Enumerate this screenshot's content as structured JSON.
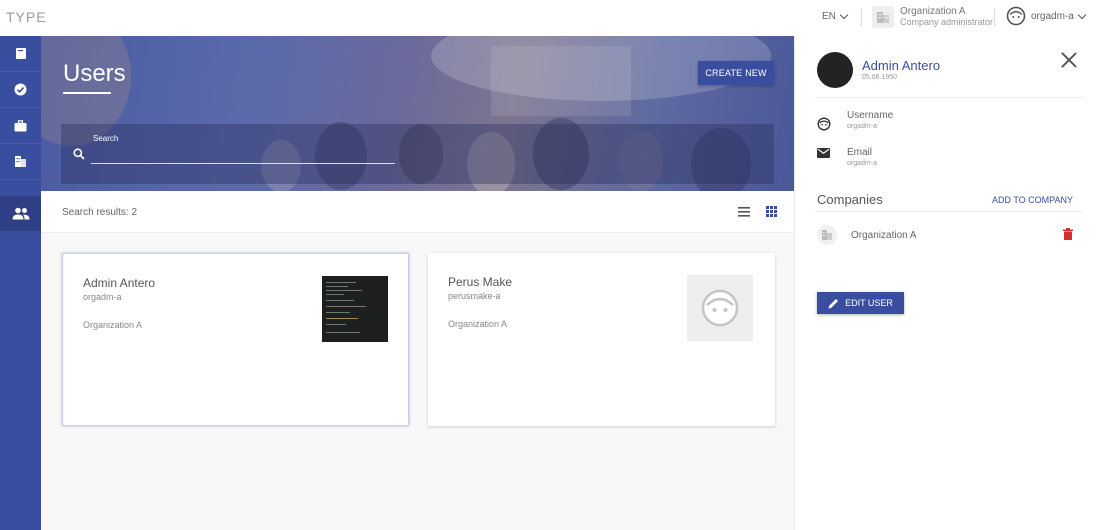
{
  "app": {
    "brand": "TYPE"
  },
  "topbar": {
    "language": "EN",
    "organization": {
      "name": "Organization A",
      "role": "Company administrator"
    },
    "username": "orgadm-a"
  },
  "nav": {
    "items": [
      {
        "icon": "book-icon"
      },
      {
        "icon": "check-circle-icon"
      },
      {
        "icon": "briefcase-icon"
      },
      {
        "icon": "building-icon"
      },
      {
        "icon": "people-icon",
        "active": true
      }
    ]
  },
  "main": {
    "title": "Users",
    "create_label": "CREATE NEW",
    "search_label": "Search",
    "search_value": "",
    "results_text": "Search results: 2"
  },
  "users": [
    {
      "name": "Admin Antero",
      "username": "orgadm-a",
      "organization": "Organization A"
    },
    {
      "name": "Perus Make",
      "username": "perusmake-a",
      "organization": "Organization A"
    }
  ],
  "panel": {
    "name": "Admin Antero",
    "date": "05.06.1950",
    "username_label": "Username",
    "username_value": "orgadm-a",
    "email_label": "Email",
    "email_value": "orgadm-a",
    "companies_title": "Companies",
    "add_to_company_label": "ADD TO COMPANY",
    "company_name": "Organization A",
    "edit_label": "EDIT USER"
  },
  "colors": {
    "primary": "#3a4ea0",
    "delete": "#d32f2f"
  }
}
